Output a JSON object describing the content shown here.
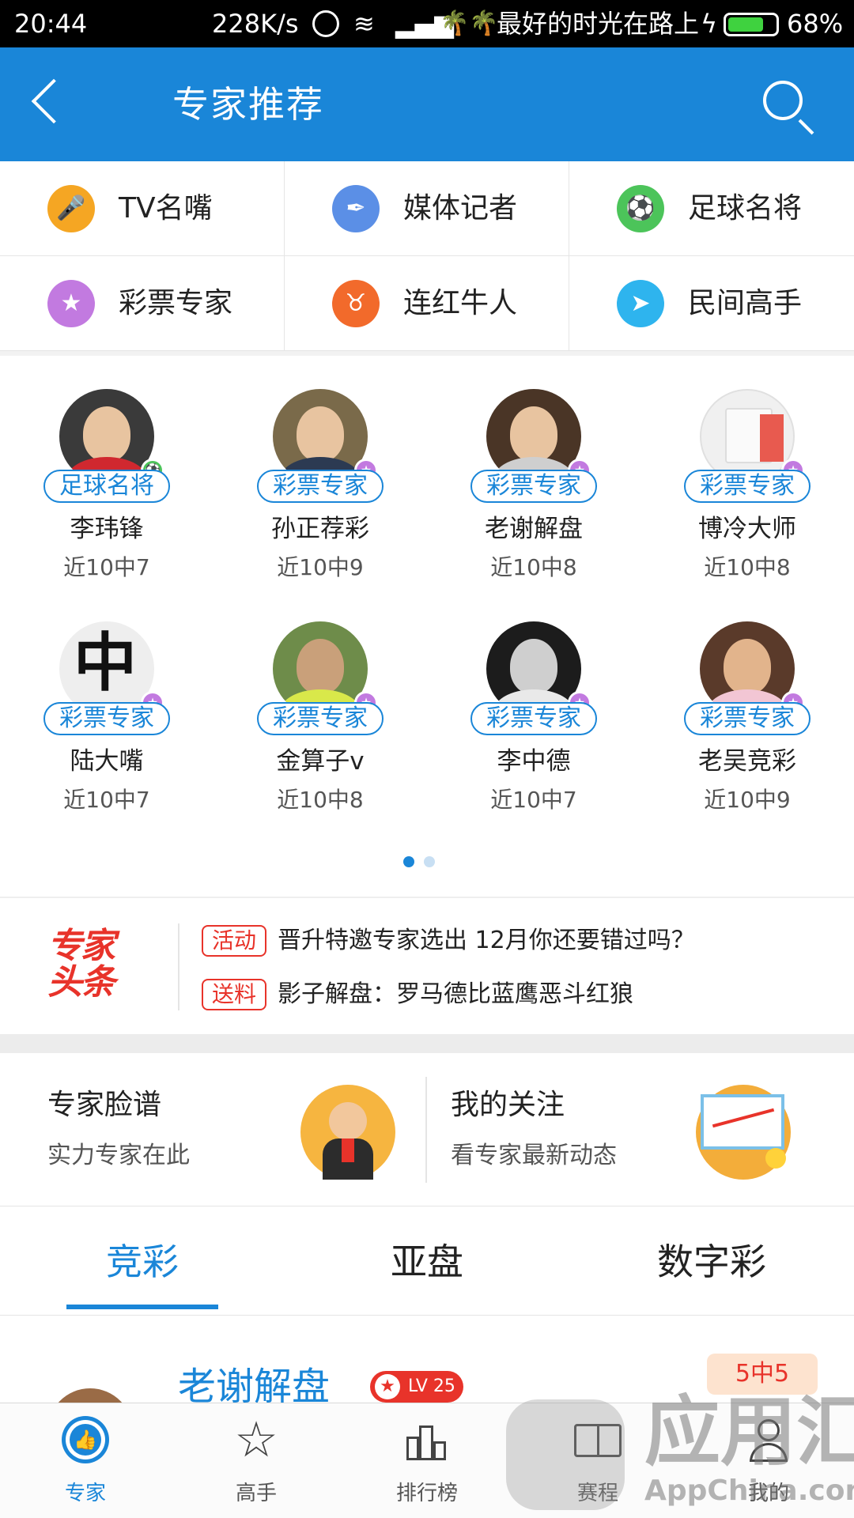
{
  "status_bar": {
    "time": "20:44",
    "speed": "228K/s",
    "carrier": "最好的时光在路上",
    "battery": "68%",
    "battery_level": 0.68
  },
  "header": {
    "title": "专家推荐"
  },
  "categories": [
    {
      "label": "TV名嘴",
      "icon": "microphone-icon",
      "color": "#f5a623"
    },
    {
      "label": "媒体记者",
      "icon": "feather-icon",
      "color": "#5b8fe6"
    },
    {
      "label": "足球名将",
      "icon": "soccer-ball-icon",
      "color": "#4cc45a"
    },
    {
      "label": "彩票专家",
      "icon": "medal-icon",
      "color": "#c27ae0"
    },
    {
      "label": "连红牛人",
      "icon": "bull-icon",
      "color": "#f26a2b"
    },
    {
      "label": "民间高手",
      "icon": "paper-plane-icon",
      "color": "#2eb4ee"
    }
  ],
  "experts": [
    {
      "tag": "足球名将",
      "name": "李玮锋",
      "record": "近10中7"
    },
    {
      "tag": "彩票专家",
      "name": "孙正荐彩",
      "record": "近10中9"
    },
    {
      "tag": "彩票专家",
      "name": "老谢解盘",
      "record": "近10中8"
    },
    {
      "tag": "彩票专家",
      "name": "博冷大师",
      "record": "近10中8"
    },
    {
      "tag": "彩票专家",
      "name": "陆大嘴",
      "record": "近10中7"
    },
    {
      "tag": "彩票专家",
      "name": "金算子v",
      "record": "近10中8"
    },
    {
      "tag": "彩票专家",
      "name": "李中德",
      "record": "近10中7"
    },
    {
      "tag": "彩票专家",
      "name": "老吴竞彩",
      "record": "近10中9"
    }
  ],
  "headlines": {
    "logo": "专家头条",
    "items": [
      {
        "chip": "活动",
        "text": "晋升特邀专家选出 12月你还要错过吗？"
      },
      {
        "chip": "送料",
        "text": "影子解盘：罗马德比蓝鹰恶斗红狼"
      }
    ]
  },
  "features": [
    {
      "title": "专家脸谱",
      "subtitle": "实力专家在此"
    },
    {
      "title": "我的关注",
      "subtitle": "看专家最新动态"
    }
  ],
  "tabs": [
    {
      "label": "竞彩"
    },
    {
      "label": "亚盘"
    },
    {
      "label": "数字彩"
    }
  ],
  "list_item": {
    "name": "老谢解盘",
    "level": "LV 25",
    "rate": "5中5"
  },
  "bottom_nav": [
    {
      "label": "专家",
      "icon": "thumbs-up-icon"
    },
    {
      "label": "高手",
      "icon": "star-icon"
    },
    {
      "label": "排行榜",
      "icon": "ranking-icon"
    },
    {
      "label": "赛程",
      "icon": "field-icon"
    },
    {
      "label": "我的",
      "icon": "user-icon"
    }
  ],
  "watermark": {
    "big": "应用汇",
    "small": "AppChina.com"
  },
  "colors": {
    "primary": "#1a86d8",
    "accent_red": "#e8332a"
  }
}
